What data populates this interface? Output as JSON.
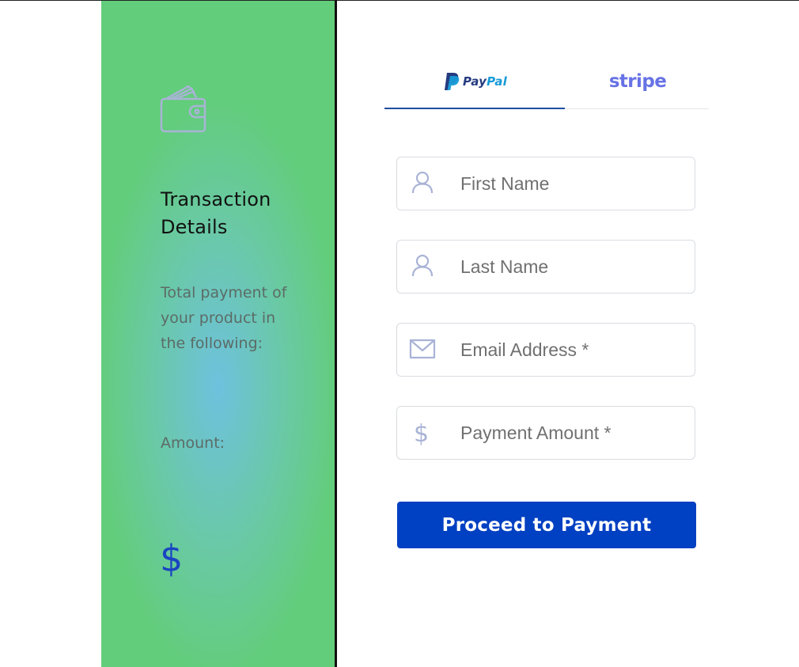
{
  "sidebar": {
    "wallet_icon": "wallet-icon",
    "title": "Transaction Details",
    "description": "Total payment of your product in the following:",
    "amount_label": "Amount:",
    "currency_symbol": "$"
  },
  "tabs": [
    {
      "label_part1": "Pay",
      "label_part2": "Pal",
      "icon": "paypal-logo-icon",
      "active": true
    },
    {
      "label": "stripe",
      "icon": "stripe-logo",
      "active": false
    }
  ],
  "form": {
    "first_name": {
      "placeholder": "First Name",
      "value": "",
      "icon": "user-icon"
    },
    "last_name": {
      "placeholder": "Last Name",
      "value": "",
      "icon": "user-icon"
    },
    "email": {
      "placeholder": "Email Address *",
      "value": "",
      "icon": "envelope-icon"
    },
    "amount": {
      "placeholder": "Payment Amount *",
      "value": "",
      "icon": "dollar-icon"
    },
    "submit_label": "Proceed to Payment"
  },
  "colors": {
    "accent_button": "#0040c2",
    "paypal_dark": "#253b80",
    "paypal_light": "#179bd7",
    "stripe": "#6772e5",
    "sidebar_green": "#62cd7a",
    "sidebar_blue": "#6ec1de"
  }
}
